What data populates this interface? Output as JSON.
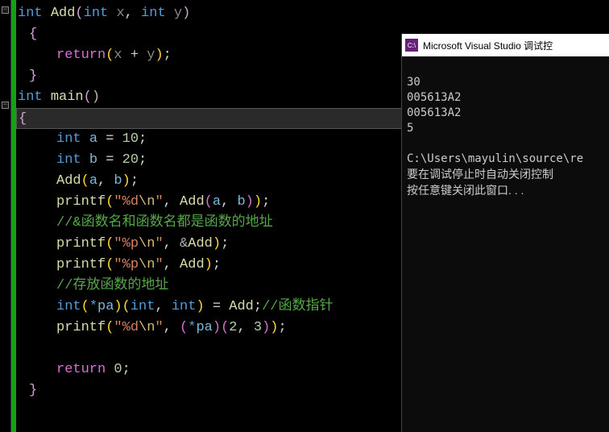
{
  "code": {
    "l1": {
      "kw": "int",
      "fn": "Add",
      "p1": "int",
      "a1": "x",
      "p2": "int",
      "a2": "y"
    },
    "l2": {
      "brace": "{"
    },
    "l3": {
      "kw": "return",
      "expr_open": "(",
      "a": "x",
      "op": " + ",
      "b": "y",
      "expr_close": ")",
      "semi": ";"
    },
    "l4": {
      "brace": "}"
    },
    "l5": {
      "kw": "int",
      "fn": "main",
      "paren": "()"
    },
    "l6": {
      "brace": "{"
    },
    "l7": {
      "kw": "int",
      "id": "a",
      "eq": " = ",
      "num": "10",
      "semi": ";"
    },
    "l8": {
      "kw": "int",
      "id": "b",
      "eq": " = ",
      "num": "20",
      "semi": ";"
    },
    "l9": {
      "fn": "Add",
      "a": "a",
      "b": "b",
      "semi": ";"
    },
    "l10": {
      "fn": "printf",
      "str1": "\"%d",
      "esc": "\\n",
      "str2": "\"",
      "fn2": "Add",
      "a": "a",
      "b": "b",
      "semi": ";"
    },
    "l11": {
      "comment": "//&函数名和函数名都是函数的地址"
    },
    "l12": {
      "fn": "printf",
      "str1": "\"%p",
      "esc": "\\n",
      "str2": "\"",
      "op": "&",
      "id": "Add",
      "semi": ";"
    },
    "l13": {
      "fn": "printf",
      "str1": "\"%p",
      "esc": "\\n",
      "str2": "\"",
      "id": "Add",
      "semi": ";"
    },
    "l14": {
      "comment": "//存放函数的地址"
    },
    "l15": {
      "kw": "int",
      "star": "*",
      "id": "pa",
      "t1": "int",
      "t2": "int",
      "eq": " = ",
      "fn": "Add",
      "semi": ";",
      "comment": "//函数指针"
    },
    "l16": {
      "fn": "printf",
      "str1": "\"%d",
      "esc": "\\n",
      "str2": "\"",
      "star": "*",
      "id": "pa",
      "n1": "2",
      "n2": "3",
      "semi": ";"
    },
    "l17": {
      "kw": "return",
      "num": "0",
      "semi": ";"
    },
    "l18": {
      "brace": "}"
    }
  },
  "console": {
    "title": "Microsoft Visual Studio 调试控",
    "icon_text": "C:\\",
    "lines": {
      "l1": "30",
      "l2": "005613A2",
      "l3": "005613A2",
      "l4": "5",
      "l5": "",
      "l6": "C:\\Users\\mayulin\\source\\re",
      "l7": "要在调试停止时自动关闭控制",
      "l8": "按任意键关闭此窗口. . ."
    }
  }
}
